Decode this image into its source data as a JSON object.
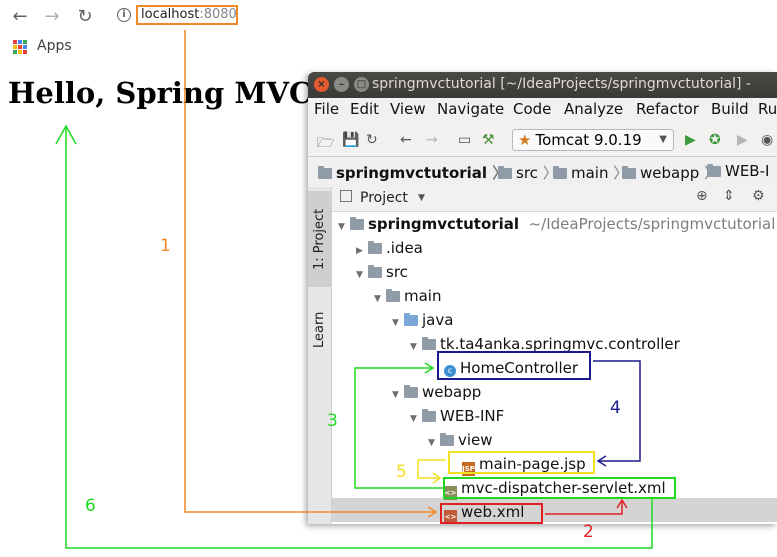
{
  "browser": {
    "url_host": "localhost",
    "url_port": ":8080",
    "bookmarks_apps_label": "Apps"
  },
  "page": {
    "heading": "Hello, Spring MVC"
  },
  "ide": {
    "title": "springmvctutorial [~/IdeaProjects/springmvctutorial] -",
    "menu": [
      "File",
      "Edit",
      "View",
      "Navigate",
      "Code",
      "Analyze",
      "Refactor",
      "Build",
      "Ru"
    ],
    "run_config": "Tomcat 9.0.19",
    "breadcrumbs": [
      "springmvctutorial",
      "src",
      "main",
      "webapp",
      "WEB-I"
    ],
    "side_tabs": {
      "project": "1: Project",
      "learn": "Learn"
    },
    "panel_title": "Project",
    "tree": {
      "root_name": "springmvctutorial",
      "root_path": "~/IdeaProjects/springmvctutorial",
      "idea": ".idea",
      "src": "src",
      "main": "main",
      "java": "java",
      "package": "tk.ta4anka.springmvc.controller",
      "controller": "HomeController",
      "webapp": "webapp",
      "webinf": "WEB-INF",
      "view": "view",
      "jsp": "main-page.jsp",
      "dispatcher": "mvc-dispatcher-servlet.xml",
      "webxml": "web.xml"
    }
  },
  "annotations": {
    "n1": "1",
    "n2": "2",
    "n3": "3",
    "n4": "4",
    "n5": "5",
    "n6": "6",
    "colors": {
      "orange": "#f08a24",
      "red": "#e02020",
      "green": "#20d820",
      "navy": "#1a1a8c",
      "yellow": "#f0e020"
    }
  }
}
